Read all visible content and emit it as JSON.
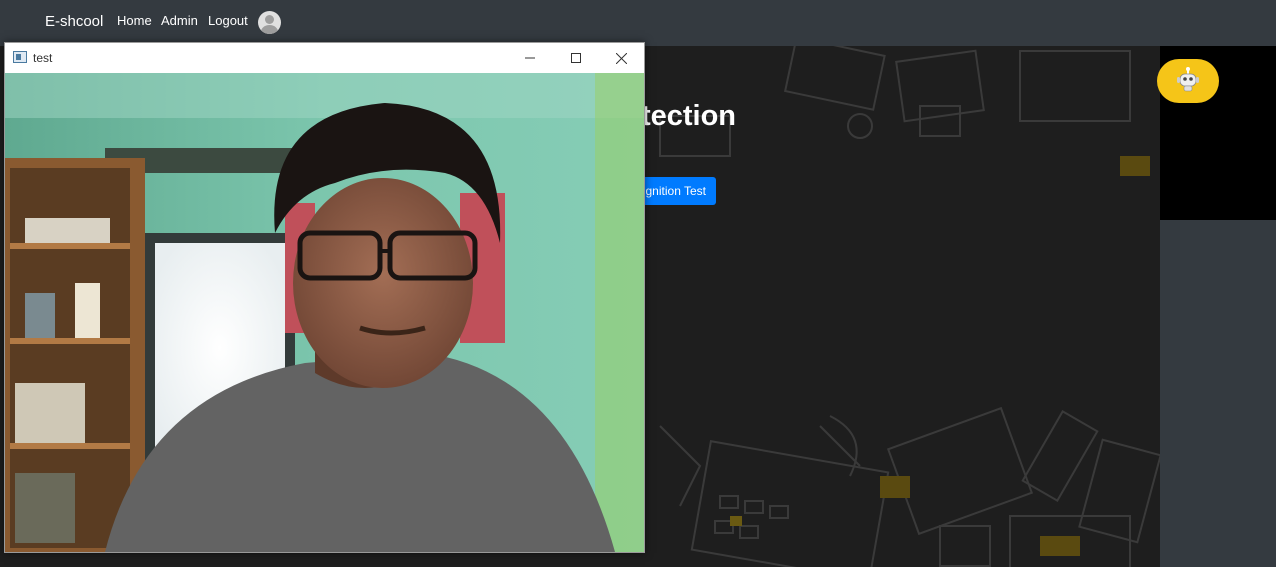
{
  "navbar": {
    "brand": "E-shcool",
    "links": [
      "Home",
      "Admin",
      "Logout"
    ]
  },
  "main": {
    "heading": "tection",
    "button_label": "gnition Test"
  },
  "window": {
    "title": "test"
  },
  "colors": {
    "navbar": "#343a40",
    "primary_button": "#007bff",
    "bot_button": "#f5c518",
    "page_background": "#1e1e1e"
  },
  "icons": [
    "user-avatar-icon",
    "robot-icon",
    "window-app-icon",
    "minimize-icon",
    "maximize-icon",
    "close-icon"
  ]
}
